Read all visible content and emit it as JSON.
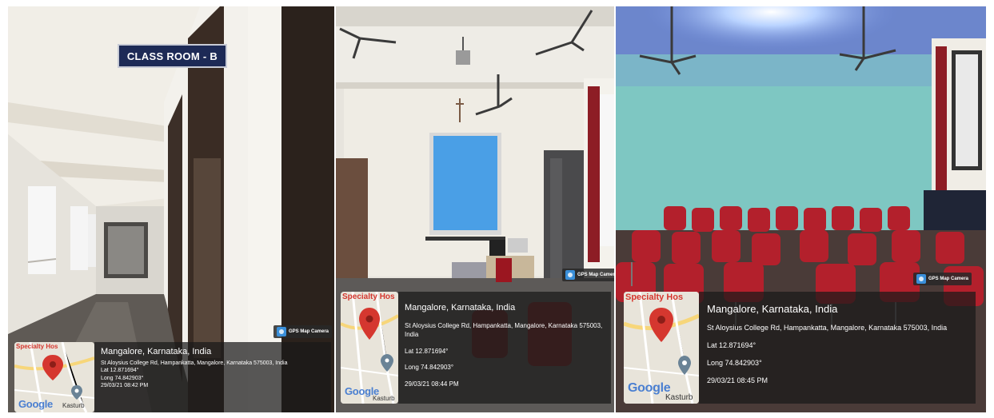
{
  "sign": {
    "text": "CLASS ROOM - B"
  },
  "gps_badge_label": "GPS Map Camera",
  "map": {
    "hospital_text": "Specialty Hos",
    "logo": "Google",
    "area": "Kasturb"
  },
  "photos": [
    {
      "place": "Mangalore, Karnataka, India",
      "address": "St Aloysius College Rd, Hampankatta, Mangalore, Karnataka 575003, India",
      "lat": "Lat 12.871694°",
      "long": "Long 74.842903°",
      "datetime": "29/03/21 08:42 PM"
    },
    {
      "place": "Mangalore, Karnataka, India",
      "address": "St Aloysius College Rd, Hampankatta, Mangalore, Karnataka 575003, India",
      "lat": "Lat 12.871694°",
      "long": "Long 74.842903°",
      "datetime": "29/03/21 08:44 PM"
    },
    {
      "place": "Mangalore, Karnataka, India",
      "address": "St Aloysius College Rd, Hampankatta, Mangalore, Karnataka 575003, India",
      "lat": "Lat 12.871694°",
      "long": "Long 74.842903°",
      "datetime": "29/03/21 08:45 PM"
    }
  ],
  "colors": {
    "wall_blue": "#7ec7c2",
    "chair_red": "#b3202c",
    "screen_blue": "#4a9fe6",
    "map_pin": "#d5372f"
  }
}
